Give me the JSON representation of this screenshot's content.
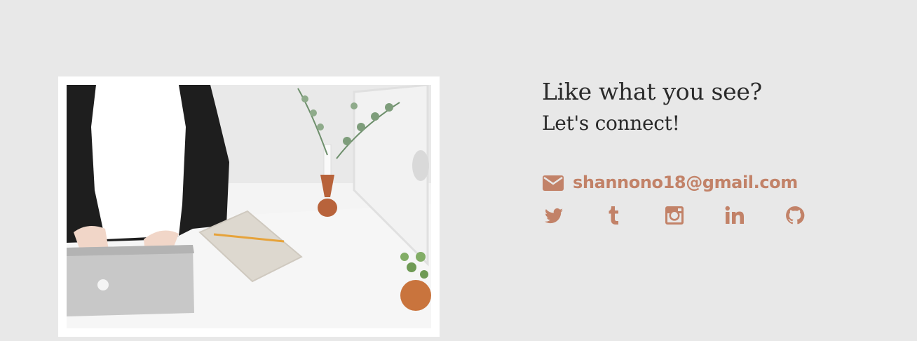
{
  "connect": {
    "heading": "Like what you see?",
    "subheading": "Let's connect!",
    "email": "shannono18@gmail.com"
  },
  "social": [
    "twitter-icon",
    "tumblr-icon",
    "instagram-icon",
    "linkedin-icon",
    "github-icon"
  ],
  "colors": {
    "background": "#e8e8e8",
    "accent": "#c28268",
    "text": "#2a2a2a"
  }
}
